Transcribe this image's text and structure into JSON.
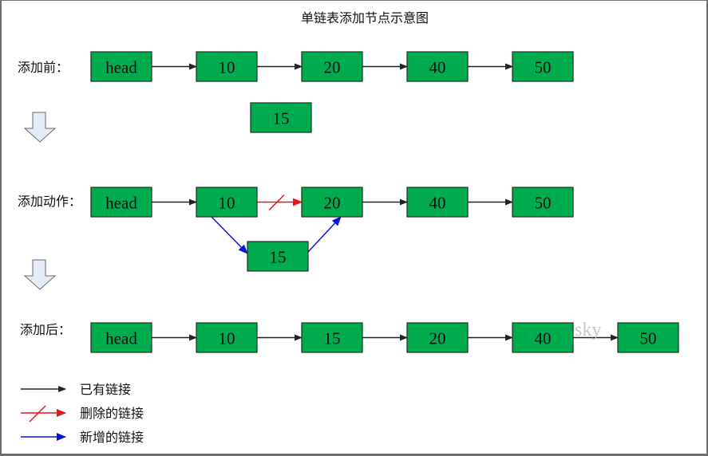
{
  "title": "单链表添加节点示意图",
  "watermark": "sky",
  "colors": {
    "node_fill": "#00ab4e",
    "existing_link": "#222222",
    "deleted_link": "#e8141b",
    "new_link": "#0a14d8",
    "down_arrow_fill": "#e4ecf7"
  },
  "rows": [
    {
      "id": "before",
      "label": "添加前：",
      "nodes": [
        "head",
        "10",
        "20",
        "40",
        "50"
      ],
      "floating_node": "15"
    },
    {
      "id": "action",
      "label": "添加动作：",
      "nodes": [
        "head",
        "10",
        "20",
        "40",
        "50"
      ],
      "inserted_node": "15",
      "deleted_link": [
        "10",
        "20"
      ],
      "new_links": [
        [
          "10",
          "15"
        ],
        [
          "15",
          "20"
        ]
      ]
    },
    {
      "id": "after",
      "label": "添加后：",
      "nodes": [
        "head",
        "10",
        "15",
        "20",
        "40",
        "50"
      ]
    }
  ],
  "legend": [
    {
      "type": "existing",
      "label": "已有链接"
    },
    {
      "type": "deleted",
      "label": "删除的链接"
    },
    {
      "type": "new",
      "label": "新增的链接"
    }
  ]
}
